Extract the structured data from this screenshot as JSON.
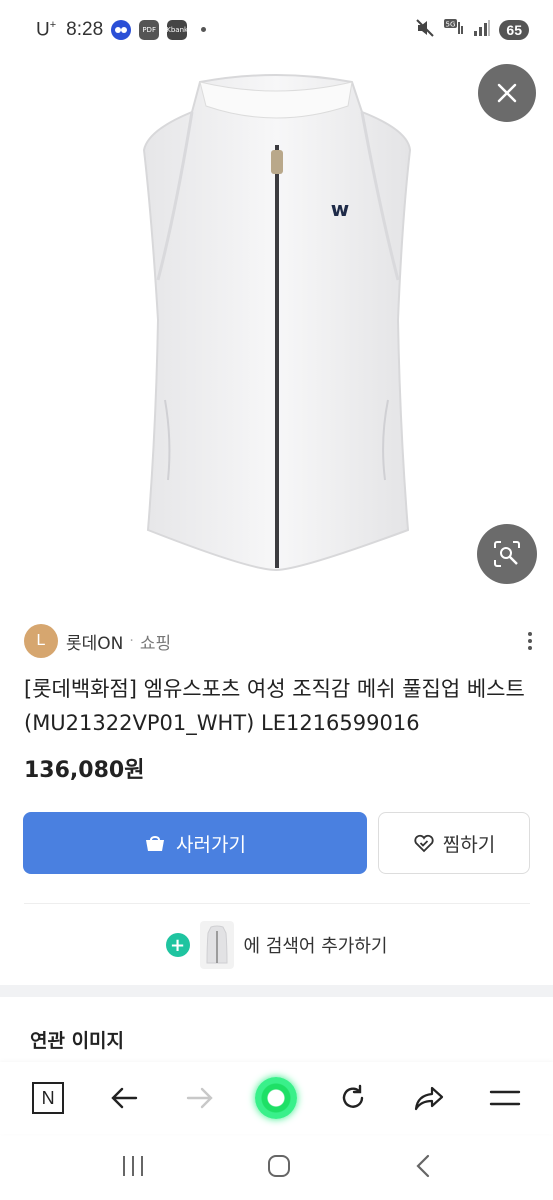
{
  "status_bar": {
    "carrier": "U",
    "carrier_sup": "+",
    "time": "8:28",
    "notif_icons": [
      {
        "name": "app-icon",
        "label": "",
        "color": "#2a4fd6"
      },
      {
        "name": "pdf-icon",
        "label": "PDF",
        "color": "#555555"
      },
      {
        "name": "kbank-icon",
        "label": "Kbank",
        "color": "#444444"
      }
    ],
    "battery": "65"
  },
  "product": {
    "seller_initial": "L",
    "seller_name": "롯데ON",
    "separator": "·",
    "category": "쇼핑",
    "title": "[롯데백화점] 엠유스포츠 여성 조직감 메쉬 풀집업 베스트 (MU21322VP01_WHT) LE1216599016",
    "price": "136,080원"
  },
  "actions": {
    "buy_label": "사러가기",
    "wish_label": "찜하기"
  },
  "search_add": {
    "text": "에 검색어 추가하기"
  },
  "related": {
    "title": "연관 이미지"
  },
  "browser_bar": {
    "home_letter": "N"
  },
  "colors": {
    "accent": "#4a80e0",
    "seller_avatar": "#d6a66f",
    "plus_icon": "#1fc4a0",
    "overlay_button": "#6b6b6b"
  }
}
